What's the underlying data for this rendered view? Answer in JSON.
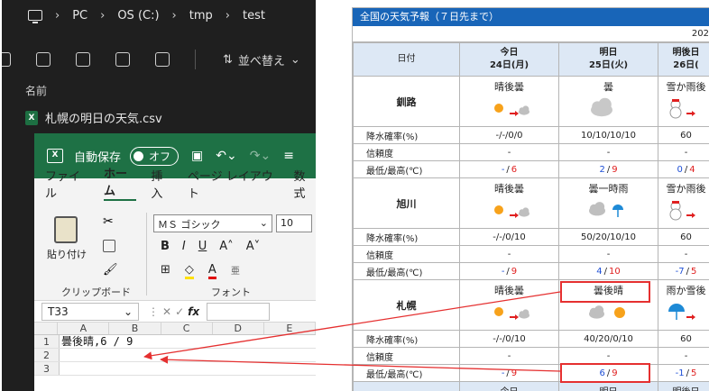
{
  "explorer": {
    "breadcrumb": [
      "PC",
      "OS (C:)",
      "tmp",
      "test"
    ],
    "sort_label": "並べ替え",
    "column_name": "名前",
    "file_name": "札幌の明日の天気.csv"
  },
  "excel": {
    "autosave_label": "自動保存",
    "autosave_state": "オフ",
    "menu": [
      "ファイル",
      "ホーム",
      "挿入",
      "ページ レイアウト",
      "数式"
    ],
    "paste_label": "貼り付け",
    "clipboard_label": "クリップボード",
    "font_name": "ＭＳ ゴシック",
    "font_size": "10",
    "font_group_label": "フォント",
    "name_box": "T33",
    "fx_label": "fx",
    "columns": [
      "A",
      "B",
      "C",
      "D",
      "E"
    ],
    "rows": [
      {
        "num": "1",
        "a": "曇後晴,6 / 9"
      },
      {
        "num": "2",
        "a": ""
      },
      {
        "num": "3",
        "a": ""
      }
    ]
  },
  "weather": {
    "title": "全国の天気予報（７日先まで）",
    "year_fragment": "202",
    "date_label": "日付",
    "days": [
      {
        "line1": "今日",
        "line2": "24日(月)"
      },
      {
        "line1": "明日",
        "line2": "25日(火)"
      },
      {
        "line1": "明後日",
        "line2": "26日("
      }
    ],
    "row_labels": {
      "precip": "降水確率(%)",
      "reliability": "信頼度",
      "temps": "最低/最高(℃)"
    },
    "temp_sep": "/",
    "cities": [
      {
        "name": "釧路",
        "weather": [
          "晴後曇",
          "曇",
          "雪か雨後"
        ],
        "icons": [
          "sun-cloud",
          "cloud",
          "snow"
        ],
        "precip": [
          "-/-/0/0",
          "10/10/10/10",
          "60"
        ],
        "reliability": [
          "-",
          "-",
          "-"
        ],
        "temps": [
          [
            "-",
            "6"
          ],
          [
            "2",
            "9"
          ],
          [
            "0",
            "4"
          ]
        ]
      },
      {
        "name": "旭川",
        "weather": [
          "晴後曇",
          "曇一時雨",
          "雪か雨後"
        ],
        "icons": [
          "sun-cloud",
          "cloud-rain",
          "snow"
        ],
        "precip": [
          "-/-/0/10",
          "50/20/10/10",
          "60"
        ],
        "reliability": [
          "-",
          "-",
          "-"
        ],
        "temps": [
          [
            "-",
            "9"
          ],
          [
            "4",
            "10"
          ],
          [
            "-7",
            "5"
          ]
        ]
      },
      {
        "name": "札幌",
        "weather": [
          "晴後曇",
          "曇後晴",
          "雨か雪後"
        ],
        "icons": [
          "sun-cloud",
          "cloud-sun",
          "umbrella"
        ],
        "precip": [
          "-/-/0/10",
          "40/20/0/10",
          "60"
        ],
        "reliability": [
          "-",
          "-",
          "-"
        ],
        "temps": [
          [
            "-",
            "9"
          ],
          [
            "6",
            "9"
          ],
          [
            "-1",
            "5"
          ]
        ]
      }
    ],
    "next_header_fragment": [
      "今日",
      "明日",
      "明後日"
    ]
  },
  "colors": {
    "excel_green": "#1e7145",
    "table_header_blue": "#1865b8",
    "highlight_red": "#e53030"
  }
}
